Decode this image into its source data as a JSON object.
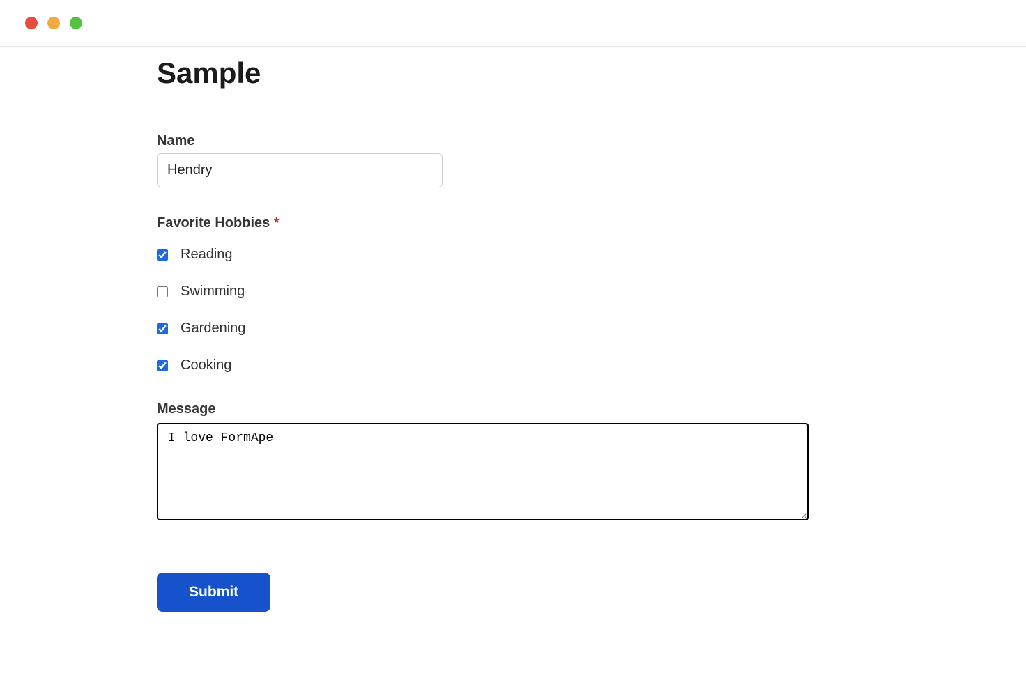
{
  "window": {
    "traffic_lights": [
      "red",
      "yellow",
      "green"
    ]
  },
  "form": {
    "title": "Sample",
    "name": {
      "label": "Name",
      "value": "Hendry",
      "required": false
    },
    "hobbies": {
      "label": "Favorite Hobbies",
      "required_mark": "*",
      "required": true,
      "options": [
        {
          "label": "Reading",
          "checked": true
        },
        {
          "label": "Swimming",
          "checked": false
        },
        {
          "label": "Gardening",
          "checked": true
        },
        {
          "label": "Cooking",
          "checked": true
        }
      ]
    },
    "message": {
      "label": "Message",
      "value": "I love FormApe",
      "required": false
    },
    "submit": {
      "label": "Submit"
    }
  }
}
